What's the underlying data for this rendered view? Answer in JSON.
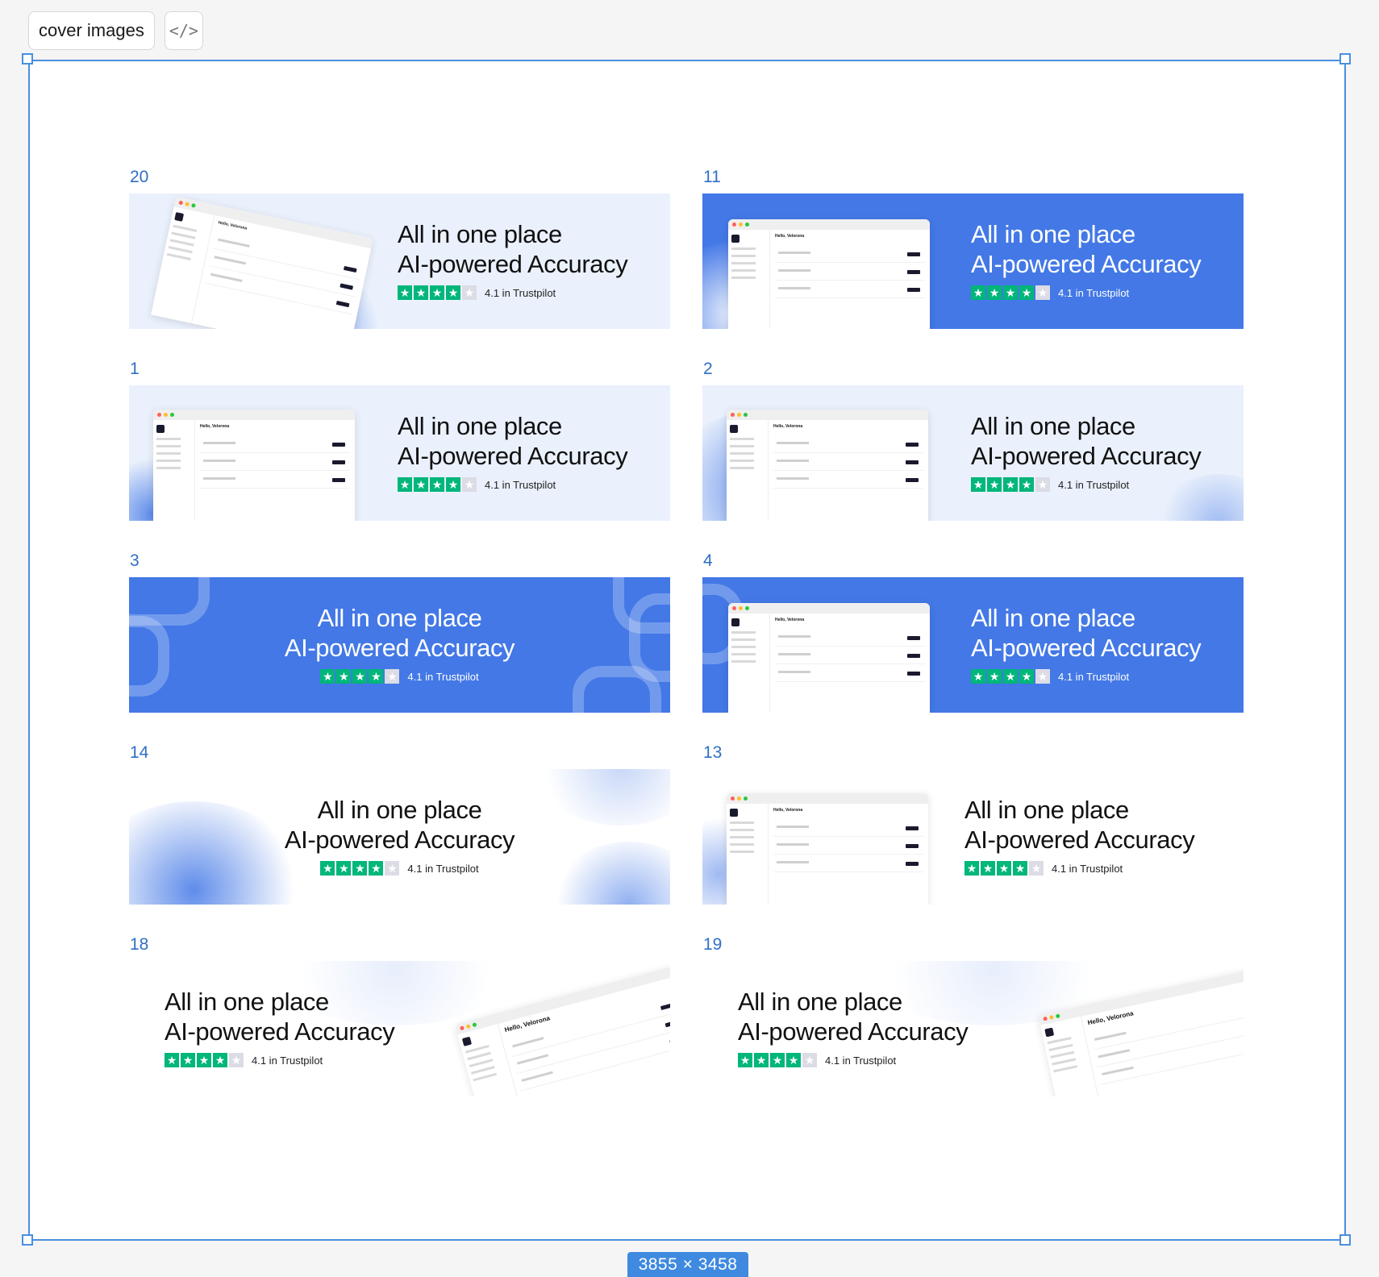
{
  "toolbar": {
    "frame_label": "cover images",
    "code_icon_glyph": "</>"
  },
  "frame": {
    "size_label": "3855 × 3458"
  },
  "cards": [
    {
      "number": "20",
      "line1": "All in one place",
      "line2": "AI-powered Accuracy",
      "rating": "4.1 in Trustpilot"
    },
    {
      "number": "11",
      "line1": "All in one place",
      "line2": "AI-powered Accuracy",
      "rating": "4.1 in Trustpilot"
    },
    {
      "number": "1",
      "line1": "All in one place",
      "line2": "AI-powered Accuracy",
      "rating": "4.1 in Trustpilot"
    },
    {
      "number": "2",
      "line1": "All in one place",
      "line2": "AI-powered Accuracy",
      "rating": "4.1 in Trustpilot"
    },
    {
      "number": "3",
      "line1": "All in one place",
      "line2": "AI-powered Accuracy",
      "rating": "4.1 in Trustpilot"
    },
    {
      "number": "4",
      "line1": "All in one place",
      "line2": "AI-powered Accuracy",
      "rating": "4.1 in Trustpilot"
    },
    {
      "number": "14",
      "line1": "All in one place",
      "line2": "AI-powered Accuracy",
      "rating": "4.1 in Trustpilot"
    },
    {
      "number": "13",
      "line1": "All in one place",
      "line2": "AI-powered Accuracy",
      "rating": "4.1 in Trustpilot"
    },
    {
      "number": "18",
      "line1": "All in one place",
      "line2": "AI-powered Accuracy",
      "rating": "4.1 in Trustpilot"
    },
    {
      "number": "19",
      "line1": "All in one place",
      "line2": "AI-powered Accuracy",
      "rating": "4.1 in Trustpilot"
    }
  ],
  "mock_app": {
    "greeting": "Hello, Velorona"
  },
  "colors": {
    "accent_blue": "#4378e6",
    "selection": "#4a8fe0",
    "trustpilot_green": "#00b67a"
  },
  "rating_stars_filled": 4,
  "rating_stars_total": 5
}
